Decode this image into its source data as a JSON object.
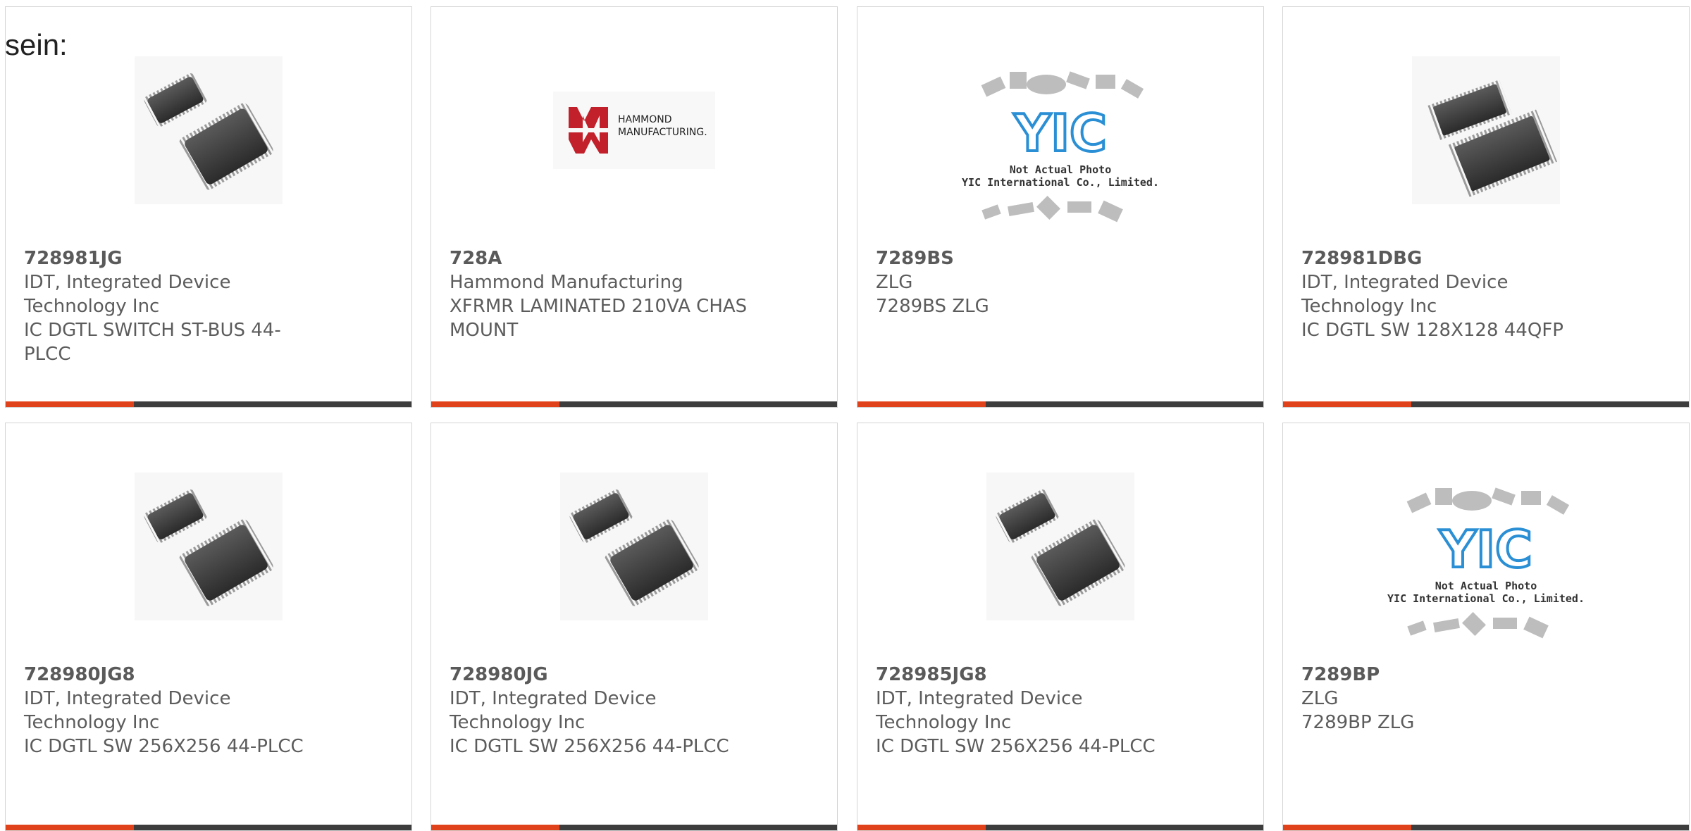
{
  "lead_text": "sein:",
  "colors": {
    "accent": "#e0421b",
    "bar": "#3d3d3d",
    "text": "#5c5c5c",
    "border": "#d4d4d4"
  },
  "cards": [
    {
      "part": "728981JG",
      "manufacturer": "IDT, Integrated Device Technology Inc",
      "description": "IC DGTL SWITCH ST-BUS 44-PLCC",
      "image": "plcc-chip-image"
    },
    {
      "part": "728A",
      "manufacturer": "Hammond Manufacturing",
      "description": "XFRMR LAMINATED 210VA CHAS MOUNT",
      "image": "hammond-logo",
      "logo_text": [
        "HAMMOND",
        "MANUFACTURING."
      ]
    },
    {
      "part": "7289BS",
      "manufacturer": "ZLG",
      "description": "7289BS ZLG",
      "image": "placeholder-not-actual-photo",
      "logo_text": [
        "YIC",
        "Not Actual Photo",
        "YIC International Co., Limited."
      ]
    },
    {
      "part": "728981DBG",
      "manufacturer": "IDT, Integrated Device Technology Inc",
      "description": "IC DGTL SW 128X128 44QFP",
      "image": "qfp-chip-image"
    },
    {
      "part": "728980JG8",
      "manufacturer": "IDT, Integrated Device Technology Inc",
      "description": "IC DGTL SW 256X256 44-PLCC",
      "image": "plcc-chip-image"
    },
    {
      "part": "728980JG",
      "manufacturer": "IDT, Integrated Device Technology Inc",
      "description": "IC DGTL SW 256X256 44-PLCC",
      "image": "plcc-chip-image"
    },
    {
      "part": "728985JG8",
      "manufacturer": "IDT, Integrated Device Technology Inc",
      "description": "IC DGTL SW 256X256 44-PLCC",
      "image": "plcc-chip-image"
    },
    {
      "part": "7289BP",
      "manufacturer": "ZLG",
      "description": "7289BP ZLG",
      "image": "placeholder-not-actual-photo",
      "logo_text": [
        "YIC",
        "Not Actual Photo",
        "YIC International Co., Limited."
      ]
    }
  ]
}
